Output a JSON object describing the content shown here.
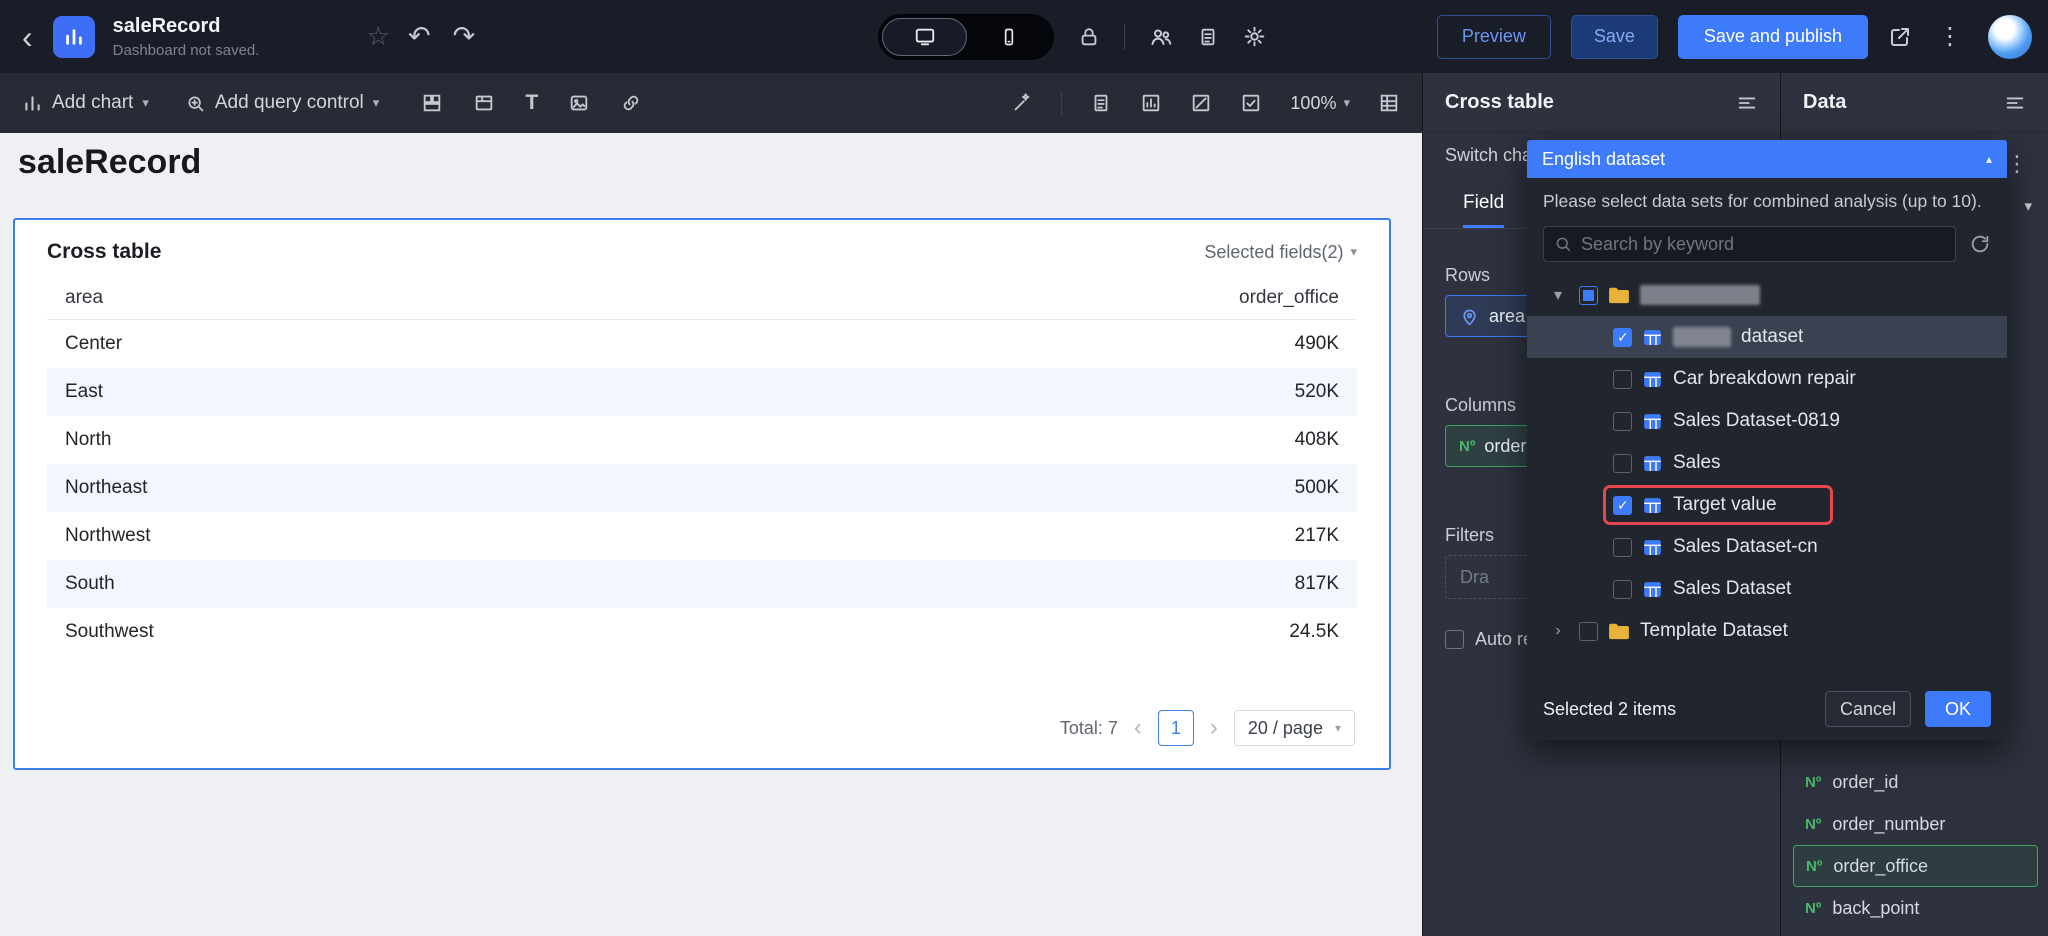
{
  "icons": {
    "back": "‹",
    "star": "☆",
    "undo": "↶",
    "redo": "↷",
    "kebab": "⋮",
    "caret_down": "▾",
    "caret_up": "▴",
    "chevron_right": "›",
    "chevron_down": "▾",
    "page_prev": "‹",
    "page_next": "›",
    "text_tool": "T",
    "numero": "Nº"
  },
  "topbar": {
    "title": "saleRecord",
    "subtitle": "Dashboard not saved.",
    "preview_button": "Preview",
    "save_button": "Save",
    "save_publish_button": "Save and publish"
  },
  "toolbar": {
    "add_chart": "Add chart",
    "add_query_control": "Add query control",
    "zoom_level": "100%"
  },
  "canvas": {
    "page_title": "saleRecord",
    "card": {
      "title": "Cross table",
      "selected_fields": "Selected fields(2)",
      "columns": [
        "area",
        "order_office"
      ],
      "rows": [
        {
          "area": "Center",
          "value": "490K"
        },
        {
          "area": "East",
          "value": "520K"
        },
        {
          "area": "North",
          "value": "408K"
        },
        {
          "area": "Northeast",
          "value": "500K"
        },
        {
          "area": "Northwest",
          "value": "217K"
        },
        {
          "area": "South",
          "value": "817K"
        },
        {
          "area": "Southwest",
          "value": "24.5K"
        }
      ],
      "pagination": {
        "total": "Total: 7",
        "current_page": "1",
        "page_size": "20 / page"
      }
    }
  },
  "config_panel": {
    "title": "Cross table",
    "switch_chart": "Switch cha",
    "field_tab": "Field",
    "rows_label": "Rows",
    "rows_field": "area",
    "columns_label": "Columns",
    "columns_field": "order",
    "filters_label": "Filters",
    "drag_hint": "Dra",
    "auto_refresh": "Auto re"
  },
  "data_panel": {
    "title": "Data",
    "fields": [
      "order_id",
      "order_number",
      "order_office",
      "back_point"
    ]
  },
  "dataset_dialog": {
    "selected_dataset": "English dataset",
    "hint": "Please select data sets for combined analysis (up to 10).",
    "search_placeholder": "Search by keyword",
    "tree": [
      {
        "label": "dataset"
      },
      {
        "label": "Car breakdown repair"
      },
      {
        "label": "Sales Dataset-0819"
      },
      {
        "label": "Sales"
      },
      {
        "label": "Target value"
      },
      {
        "label": "Sales Dataset-cn"
      },
      {
        "label": "Sales Dataset"
      },
      {
        "label": "Template Dataset"
      }
    ],
    "footer": {
      "selected_count": "Selected 2 items",
      "cancel_button": "Cancel",
      "ok_button": "OK"
    }
  },
  "colors": {
    "accent_blue": "#3e7bfa",
    "success_green": "#3fa35c",
    "annotation_red": "#e5484d",
    "folder_yellow": "#e8b339"
  }
}
